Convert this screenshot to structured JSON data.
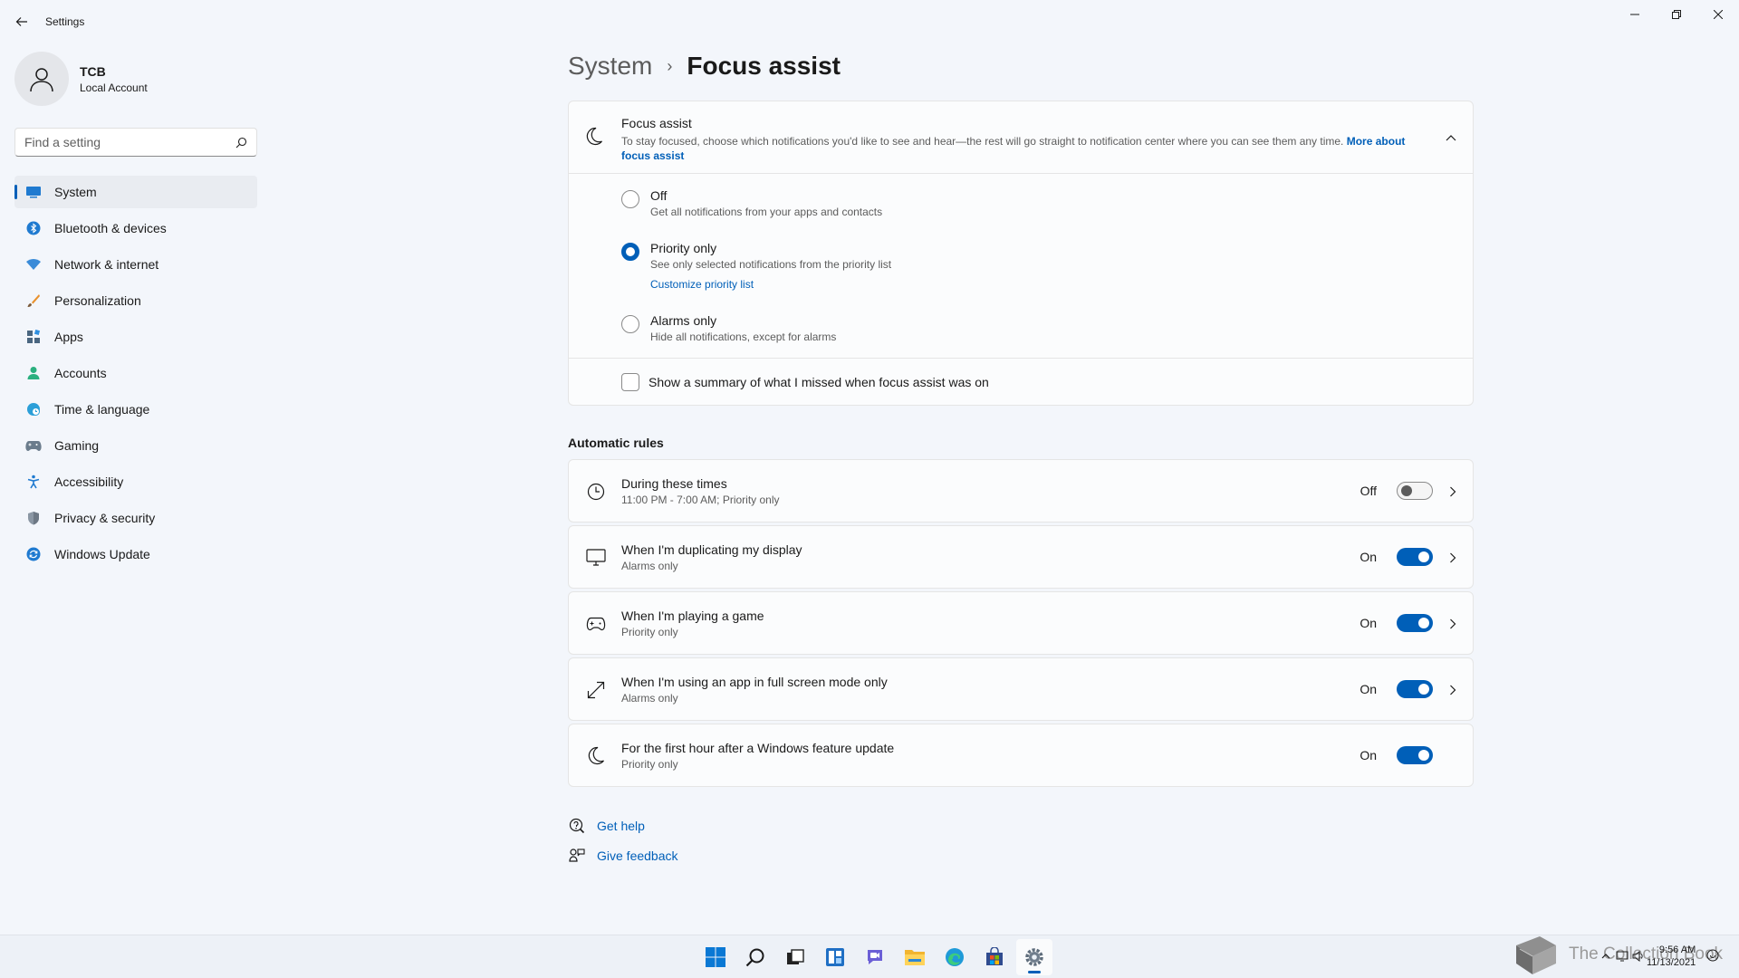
{
  "window": {
    "title": "Settings"
  },
  "profile": {
    "name": "TCB",
    "account_type": "Local Account"
  },
  "search": {
    "placeholder": "Find a setting"
  },
  "sidebar": {
    "items": [
      {
        "label": "System",
        "icon": "monitor-icon",
        "active": true
      },
      {
        "label": "Bluetooth & devices",
        "icon": "bluetooth-icon"
      },
      {
        "label": "Network & internet",
        "icon": "wifi-icon"
      },
      {
        "label": "Personalization",
        "icon": "brush-icon"
      },
      {
        "label": "Apps",
        "icon": "apps-icon"
      },
      {
        "label": "Accounts",
        "icon": "person-icon"
      },
      {
        "label": "Time & language",
        "icon": "globe-clock-icon"
      },
      {
        "label": "Gaming",
        "icon": "gamepad-icon"
      },
      {
        "label": "Accessibility",
        "icon": "accessibility-icon"
      },
      {
        "label": "Privacy & security",
        "icon": "shield-icon"
      },
      {
        "label": "Windows Update",
        "icon": "update-icon"
      }
    ]
  },
  "breadcrumb": {
    "parent": "System",
    "separator": "›",
    "current": "Focus assist"
  },
  "focus_assist": {
    "title": "Focus assist",
    "description": "To stay focused, choose which notifications you'd like to see and hear—the rest will go straight to notification center where you can see them any time.",
    "more_link": "More about focus assist",
    "options": [
      {
        "label": "Off",
        "sub": "Get all notifications from your apps and contacts",
        "checked": false
      },
      {
        "label": "Priority only",
        "sub": "See only selected notifications from the priority list",
        "link": "Customize priority list",
        "checked": true
      },
      {
        "label": "Alarms only",
        "sub": "Hide all notifications, except for alarms",
        "checked": false
      }
    ],
    "summary_label": "Show a summary of what I missed when focus assist was on",
    "summary_checked": false
  },
  "automatic_rules": {
    "title": "Automatic rules",
    "rules": [
      {
        "title": "During these times",
        "sub": "11:00 PM - 7:00 AM; Priority only",
        "state": "Off",
        "on": false,
        "icon": "clock-icon",
        "chevron": true
      },
      {
        "title": "When I'm duplicating my display",
        "sub": "Alarms only",
        "state": "On",
        "on": true,
        "icon": "display-icon",
        "chevron": true
      },
      {
        "title": "When I'm playing a game",
        "sub": "Priority only",
        "state": "On",
        "on": true,
        "icon": "gamepad-icon",
        "chevron": true
      },
      {
        "title": "When I'm using an app in full screen mode only",
        "sub": "Alarms only",
        "state": "On",
        "on": true,
        "icon": "fullscreen-icon",
        "chevron": true
      },
      {
        "title": "For the first hour after a Windows feature update",
        "sub": "Priority only",
        "state": "On",
        "on": true,
        "icon": "moon-icon",
        "chevron": false
      }
    ]
  },
  "help": {
    "get_help": "Get help",
    "give_feedback": "Give feedback"
  },
  "taskbar": {
    "icons": [
      "windows-start-icon",
      "search-icon",
      "task-view-icon",
      "widgets-icon",
      "chat-icon",
      "file-explorer-icon",
      "edge-icon",
      "store-icon",
      "settings-icon"
    ],
    "watermark": "The Collection Book",
    "time": "9:56 AM",
    "date": "11/13/2021"
  },
  "colors": {
    "accent": "#005fb8",
    "background": "#f3f6fb",
    "card": "#fbfcfd"
  }
}
